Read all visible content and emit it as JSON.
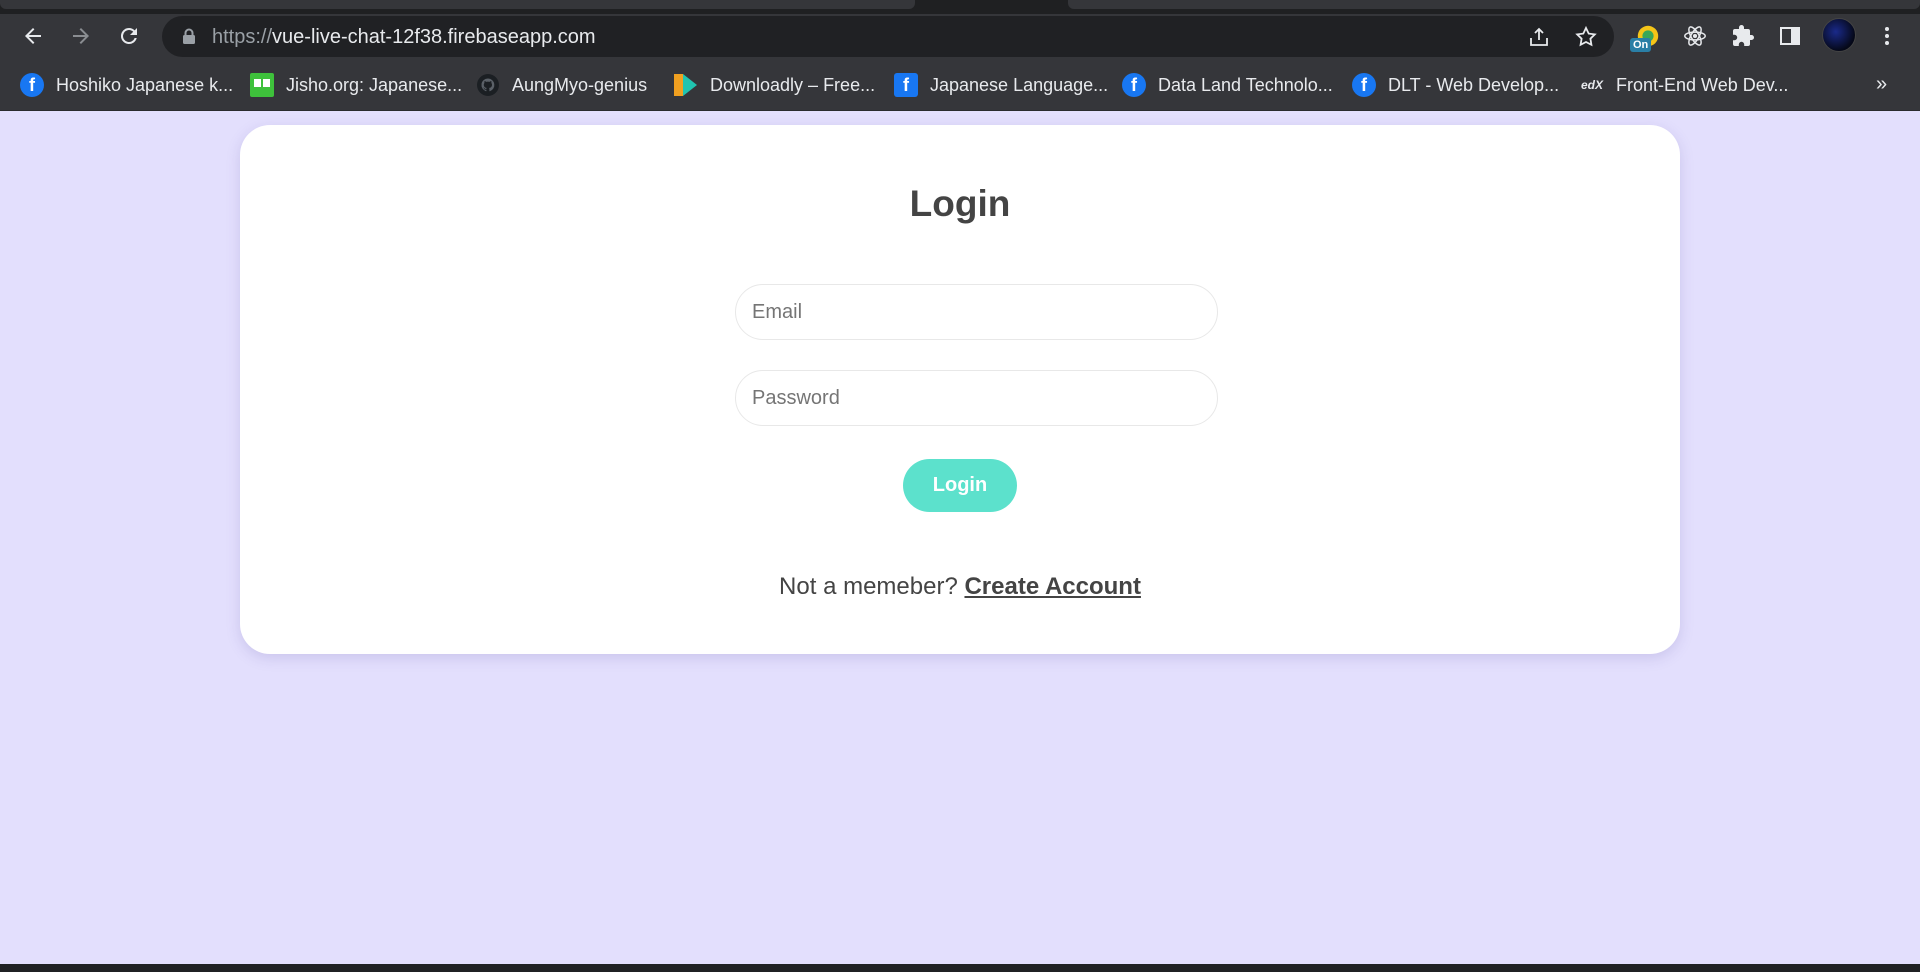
{
  "browser": {
    "url_scheme": "https://",
    "url_host": "vue-live-chat-12f38.firebaseapp.com",
    "extension_badge": "On",
    "bookmarks": [
      {
        "label": "Hoshiko Japanese k...",
        "icon": "facebook-icon"
      },
      {
        "label": "Jisho.org: Japanese...",
        "icon": "jisho-icon"
      },
      {
        "label": "AungMyo-genius",
        "icon": "github-icon"
      },
      {
        "label": "Downloadly – Free...",
        "icon": "downloadly-icon"
      },
      {
        "label": "Japanese Language...",
        "icon": "facebook-icon"
      },
      {
        "label": "Data Land Technolo...",
        "icon": "facebook-icon"
      },
      {
        "label": "DLT - Web Develop...",
        "icon": "facebook-icon"
      },
      {
        "label": "Front-End Web Dev...",
        "icon": "edx-icon"
      }
    ],
    "bookmarks_overflow": "»"
  },
  "login": {
    "title": "Login",
    "email_placeholder": "Email",
    "password_placeholder": "Password",
    "email_value": "",
    "password_value": "",
    "submit_label": "Login",
    "switch_prompt": "Not a memeber?",
    "switch_link": "Create Account"
  },
  "colors": {
    "page_background": "#e3dffd",
    "card_background": "#ffffff",
    "button_background": "#5ce1cc",
    "text": "#444444"
  }
}
